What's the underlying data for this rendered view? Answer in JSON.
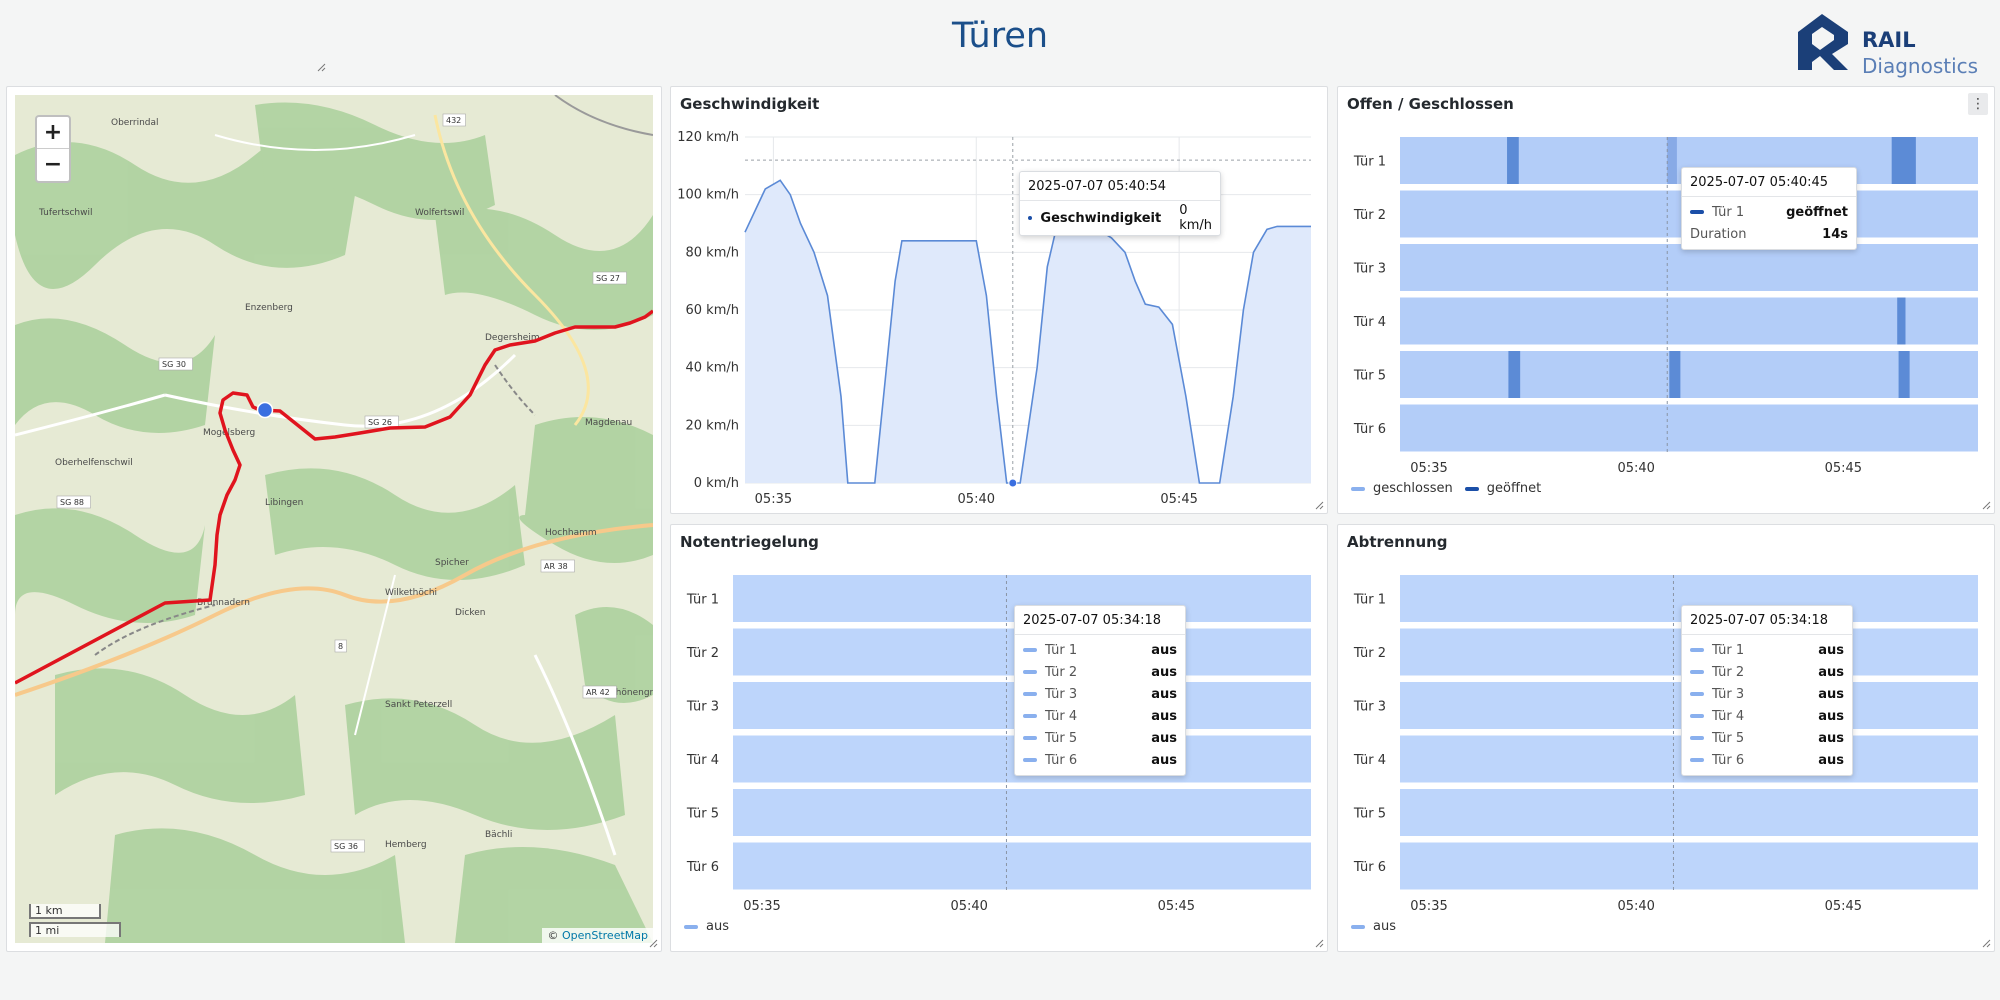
{
  "header": {
    "title": "Türen",
    "logo_line1": "RAIL",
    "logo_line2": "Diagnostics"
  },
  "map": {
    "attribution_prefix": "© ",
    "attribution_link": "OpenStreetMap",
    "scale_km": "1 km",
    "scale_mi": "1 mi",
    "zoom_in": "+",
    "zoom_out": "−",
    "places": [
      "Oberrindal",
      "Tufertschwil",
      "Wolfertswil",
      "Degersheim",
      "Magdenau",
      "Mogelsberg",
      "Oberhelfenschwil",
      "Brunnadern",
      "Dicken",
      "Schönengrund",
      "Sankt Peterzell",
      "Hemberg",
      "Bächli",
      "Hochhamm",
      "Wilkethöchi",
      "Spicher",
      "Libingen",
      "Enzenberg"
    ],
    "roads": [
      "432",
      "SG 27",
      "SG 30",
      "SG 26",
      "SG 88",
      "AR 38",
      "AR 42",
      "8",
      "SG 36"
    ]
  },
  "speed": {
    "title": "Geschwindigkeit",
    "tooltip": {
      "time": "2025-07-07 05:40:54",
      "label": "Geschwindigkeit",
      "value": "0 km/h"
    },
    "color": "#5b8ad6",
    "fill": "#dfe9fb"
  },
  "offen": {
    "title": "Offen / Geschlossen",
    "menu_icon": "⋮",
    "tooltip": {
      "time": "2025-07-07 05:40:45",
      "rows": [
        {
          "label": "Tür 1",
          "value": "geöffnet"
        },
        {
          "label": "Duration",
          "value": "14s"
        }
      ]
    },
    "legend": [
      "geschlossen",
      "geöffnet"
    ],
    "colors": {
      "closed": "#b3cdf8",
      "open": "#5c8bd6",
      "open_dark": "#1b4fa8",
      "open_light": "#88aae6"
    }
  },
  "notent": {
    "title": "Notentriegelung",
    "tooltip": {
      "time": "2025-07-07 05:34:18",
      "rows": [
        {
          "label": "Tür 1",
          "value": "aus"
        },
        {
          "label": "Tür 2",
          "value": "aus"
        },
        {
          "label": "Tür 3",
          "value": "aus"
        },
        {
          "label": "Tür 4",
          "value": "aus"
        },
        {
          "label": "Tür 5",
          "value": "aus"
        },
        {
          "label": "Tür 6",
          "value": "aus"
        }
      ]
    },
    "legend": [
      "aus"
    ],
    "color": "#bdd5fb"
  },
  "abtren": {
    "title": "Abtrennung",
    "tooltip": {
      "time": "2025-07-07 05:34:18",
      "rows": [
        {
          "label": "Tür 1",
          "value": "aus"
        },
        {
          "label": "Tür 2",
          "value": "aus"
        },
        {
          "label": "Tür 3",
          "value": "aus"
        },
        {
          "label": "Tür 4",
          "value": "aus"
        },
        {
          "label": "Tür 5",
          "value": "aus"
        },
        {
          "label": "Tür 6",
          "value": "aus"
        }
      ]
    },
    "legend": [
      "aus"
    ],
    "color": "#bdd5fb"
  },
  "chart_data": [
    {
      "type": "line",
      "title": "Geschwindigkeit",
      "x_unit": "time (2025-07-07)",
      "ylim": [
        0,
        120
      ],
      "y_ticks": [
        "0 km/h",
        "20 km/h",
        "40 km/h",
        "60 km/h",
        "80 km/h",
        "100 km/h",
        "120 km/h"
      ],
      "x_ticks": [
        "05:35",
        "05:40",
        "05:45"
      ],
      "x_range": [
        "05:34:18",
        "05:48:15"
      ],
      "threshold": 112,
      "series": [
        {
          "name": "Geschwindigkeit",
          "x": [
            "05:34:18",
            "05:34:48",
            "05:35:10",
            "05:35:25",
            "05:35:40",
            "05:36:00",
            "05:36:20",
            "05:36:40",
            "05:36:50",
            "05:37:00",
            "05:37:30",
            "05:37:45",
            "05:38:00",
            "05:38:10",
            "05:38:20",
            "05:39:00",
            "05:39:30",
            "05:39:50",
            "05:40:00",
            "05:40:15",
            "05:40:30",
            "05:40:45",
            "05:40:54",
            "05:41:05",
            "05:41:30",
            "05:41:45",
            "05:42:00",
            "05:42:30",
            "05:43:00",
            "05:43:20",
            "05:43:40",
            "05:43:55",
            "05:44:10",
            "05:44:30",
            "05:44:50",
            "05:45:10",
            "05:45:30",
            "05:45:40",
            "05:46:00",
            "05:46:20",
            "05:46:35",
            "05:46:50",
            "05:47:10",
            "05:47:25",
            "05:47:35",
            "05:48:15"
          ],
          "values": [
            87,
            102,
            105,
            100,
            90,
            80,
            65,
            30,
            0,
            0,
            0,
            35,
            70,
            84,
            84,
            84,
            84,
            84,
            84,
            65,
            30,
            0,
            0,
            0,
            40,
            75,
            90,
            90,
            88,
            85,
            80,
            70,
            62,
            61,
            55,
            30,
            0,
            0,
            0,
            30,
            60,
            80,
            88,
            89,
            89,
            89
          ]
        }
      ]
    },
    {
      "type": "timeline",
      "title": "Offen / Geschlossen",
      "rows": [
        "Tür 1",
        "Tür 2",
        "Tür 3",
        "Tür 4",
        "Tür 5",
        "Tür 6"
      ],
      "x_ticks": [
        "05:35",
        "05:40",
        "05:45"
      ],
      "x_range": [
        "05:34:18",
        "05:48:15"
      ],
      "legend": [
        "geschlossen",
        "geöffnet"
      ],
      "states": [
        {
          "row": "Tür 1",
          "state": "geöffnet",
          "start": "05:36:53",
          "end": "05:37:10"
        },
        {
          "row": "Tür 1",
          "state": "geöffnet",
          "start": "05:40:45",
          "end": "05:40:59"
        },
        {
          "row": "Tür 1",
          "state": "geöffnet",
          "start": "05:46:10",
          "end": "05:46:45"
        },
        {
          "row": "Tür 4",
          "state": "geöffnet",
          "start": "05:46:18",
          "end": "05:46:30"
        },
        {
          "row": "Tür 5",
          "state": "geöffnet",
          "start": "05:36:55",
          "end": "05:37:12"
        },
        {
          "row": "Tür 5",
          "state": "geöffnet",
          "start": "05:40:48",
          "end": "05:41:04"
        },
        {
          "row": "Tür 5",
          "state": "geöffnet",
          "start": "05:46:20",
          "end": "05:46:36"
        }
      ]
    },
    {
      "type": "timeline",
      "title": "Notentriegelung",
      "rows": [
        "Tür 1",
        "Tür 2",
        "Tür 3",
        "Tür 4",
        "Tür 5",
        "Tür 6"
      ],
      "x_ticks": [
        "05:35",
        "05:40",
        "05:45"
      ],
      "legend": [
        "aus"
      ],
      "states": []
    },
    {
      "type": "timeline",
      "title": "Abtrennung",
      "rows": [
        "Tür 1",
        "Tür 2",
        "Tür 3",
        "Tür 4",
        "Tür 5",
        "Tür 6"
      ],
      "x_ticks": [
        "05:35",
        "05:40",
        "05:45"
      ],
      "legend": [
        "aus"
      ],
      "states": []
    }
  ]
}
